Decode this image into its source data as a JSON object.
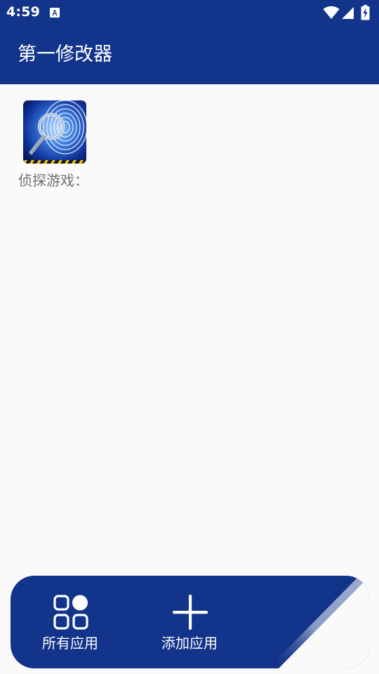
{
  "status_bar": {
    "time": "4:59",
    "notification_icon": "text-a-icon",
    "icons": [
      "wifi-icon",
      "cell-signal-icon",
      "battery-charging-icon"
    ]
  },
  "app_bar": {
    "title": "第一修改器"
  },
  "apps": [
    {
      "label": "侦探游戏：",
      "icon": "fingerprint-magnifier-icon"
    }
  ],
  "bottom_nav": {
    "items": [
      {
        "label": "所有应用",
        "icon": "apps-grid-icon"
      },
      {
        "label": "添加应用",
        "icon": "plus-icon"
      }
    ]
  },
  "colors": {
    "primary": "#12348a",
    "background": "#fafafa",
    "label_gray": "#707070"
  }
}
